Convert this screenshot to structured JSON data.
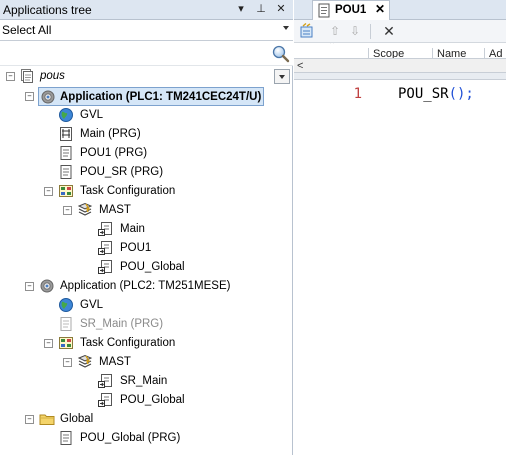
{
  "left_panel": {
    "title": "Applications tree",
    "header_buttons": [
      "▾",
      "⊥",
      "✕"
    ],
    "filter": {
      "value": "Select All"
    },
    "tree": [
      {
        "label": "pous",
        "icon": "project-icon",
        "italic": true
      },
      {
        "label": "Application (PLC1: TM241CEC24T/U)",
        "icon": "application-gear-icon",
        "bold": true,
        "selected": true
      },
      {
        "label": "GVL",
        "icon": "globe-icon"
      },
      {
        "label": "Main (PRG)",
        "icon": "program-ladder-icon"
      },
      {
        "label": "POU1 (PRG)",
        "icon": "document-icon"
      },
      {
        "label": "POU_SR (PRG)",
        "icon": "document-icon"
      },
      {
        "label": "Task Configuration",
        "icon": "task-config-icon"
      },
      {
        "label": "MAST",
        "icon": "task-stack-icon"
      },
      {
        "label": "Main",
        "icon": "program-call-icon"
      },
      {
        "label": "POU1",
        "icon": "program-call-icon"
      },
      {
        "label": "POU_Global",
        "icon": "program-call-icon"
      },
      {
        "label": "Application (PLC2: TM251MESE)",
        "icon": "application-gear-icon"
      },
      {
        "label": "GVL",
        "icon": "globe-icon"
      },
      {
        "label": "SR_Main (PRG)",
        "icon": "document-icon",
        "disabled": true
      },
      {
        "label": "Task Configuration",
        "icon": "task-config-icon"
      },
      {
        "label": "MAST",
        "icon": "task-stack-icon"
      },
      {
        "label": "SR_Main",
        "icon": "program-call-icon"
      },
      {
        "label": "POU_Global",
        "icon": "program-call-icon"
      },
      {
        "label": "Global",
        "icon": "folder-icon"
      },
      {
        "label": "POU_Global (PRG)",
        "icon": "document-icon"
      }
    ]
  },
  "editor": {
    "tab": {
      "label": "POU1",
      "close": "✕"
    },
    "columns": [
      "Scope",
      "Name",
      "Ad"
    ],
    "line_number": "1",
    "code": {
      "name": "POU_SR",
      "punct": "();"
    }
  },
  "colors": {
    "selection_bg": "#d5e6f7",
    "selection_border": "#7da2ce",
    "header_bg": "#dde6f1",
    "line_number": "#c04040",
    "code_punct": "#1f4fd6"
  }
}
